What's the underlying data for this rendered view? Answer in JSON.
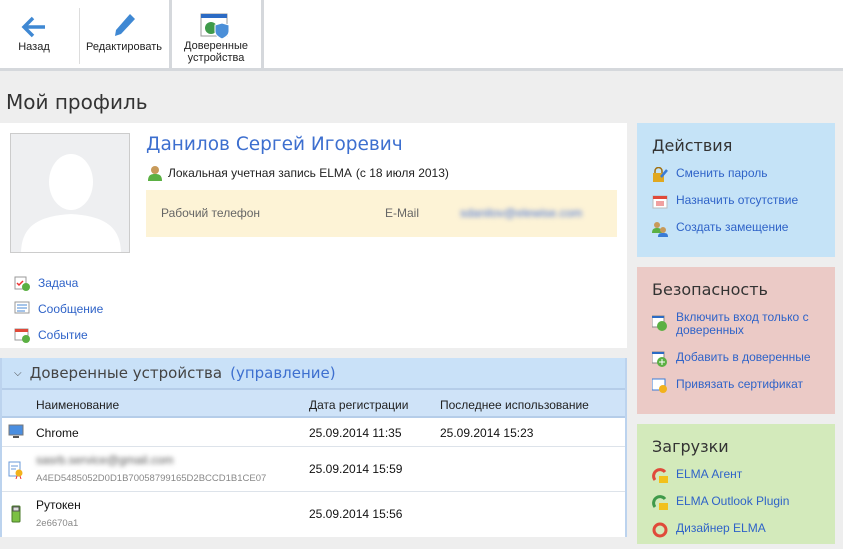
{
  "toolbar": {
    "back": "Назад",
    "edit": "Редактировать",
    "trusted_line1": "Доверенные",
    "trusted_line2": "устройства"
  },
  "page_title": "Мой профиль",
  "profile": {
    "name": "Данилов Сергей Игоревич",
    "account": "Локальная учетная запись ELMA",
    "since": "(с 18 июля 2013)",
    "work_phone_label": "Рабочий телефон",
    "email_label": "E-Mail",
    "email_value": "sdanilov@elewise.com"
  },
  "quick_actions": [
    {
      "label": "Задача",
      "icon": "task-add-icon"
    },
    {
      "label": "Сообщение",
      "icon": "message-icon"
    },
    {
      "label": "Событие",
      "icon": "event-add-icon"
    }
  ],
  "trusted_devices": {
    "title": "Доверенные устройства",
    "manage": "(управление)",
    "columns": [
      "Наименование",
      "Дата регистрации",
      "Последнее использование"
    ],
    "rows": [
      {
        "name": "Chrome",
        "sub": "",
        "registered": "25.09.2014 11:35",
        "last_used": "25.09.2014 15:23",
        "icon": "monitor-icon"
      },
      {
        "name": "sasrb.service@gmail.com",
        "sub": "A4ED5485052D0D1B70058799165D2BCCD1B1CE07",
        "registered": "25.09.2014 15:59",
        "last_used": "",
        "icon": "certificate-icon"
      },
      {
        "name": "Рутокен",
        "sub": "2e6670a1",
        "registered": "25.09.2014 15:56",
        "last_used": "",
        "icon": "usb-token-icon"
      }
    ]
  },
  "panels": {
    "actions": {
      "title": "Действия",
      "items": [
        "Сменить пароль",
        "Назначить отсутствие",
        "Создать замещение"
      ]
    },
    "security": {
      "title": "Безопасность",
      "items": [
        "Включить вход только с доверенных",
        "Добавить в доверенные",
        "Привязать сертификат"
      ]
    },
    "downloads": {
      "title": "Загрузки",
      "items": [
        "ELMA Агент",
        "ELMA Outlook Plugin",
        "Дизайнер ELMA"
      ]
    }
  },
  "colors": {
    "link": "#2f63c8",
    "actions_bg": "#c5e3f7",
    "security_bg": "#ebcac6",
    "downloads_bg": "#d3eabb"
  }
}
